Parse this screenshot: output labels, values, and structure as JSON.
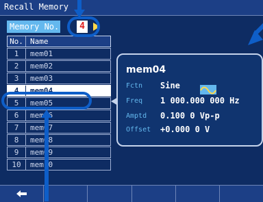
{
  "window": {
    "title": "Recall Memory"
  },
  "memory_selector": {
    "label": "Memory No.",
    "value": "4"
  },
  "table": {
    "header": {
      "no": "No.",
      "name": "Name"
    },
    "rows": [
      {
        "no": "1",
        "name": "mem01"
      },
      {
        "no": "2",
        "name": "mem02"
      },
      {
        "no": "3",
        "name": "mem03"
      },
      {
        "no": "4",
        "name": "mem04"
      },
      {
        "no": "5",
        "name": "mem05"
      },
      {
        "no": "6",
        "name": "mem06"
      },
      {
        "no": "7",
        "name": "mem07"
      },
      {
        "no": "8",
        "name": "mem08"
      },
      {
        "no": "9",
        "name": "mem09"
      },
      {
        "no": "10",
        "name": "mem10"
      }
    ],
    "selected_index": 3
  },
  "detail": {
    "name": "mem04",
    "fields": [
      {
        "key": "Fctn",
        "value": "Sine"
      },
      {
        "key": "Freq",
        "value": "1 000.000 000 Hz"
      },
      {
        "key": "Amptd",
        "value": "0.100 0 Vp-p"
      },
      {
        "key": "Offset",
        "value": "+0.000 0 V"
      }
    ],
    "waveform_icon": "sine-wave-icon"
  },
  "softkeys": {
    "first_icon": "back-arrow-icon"
  },
  "colors": {
    "background": "#0e2c63",
    "accent": "#64b8ee",
    "callout": "#0e5ec8",
    "selected_value": "#e02020",
    "pointer_arrow": "#ffd84a"
  }
}
